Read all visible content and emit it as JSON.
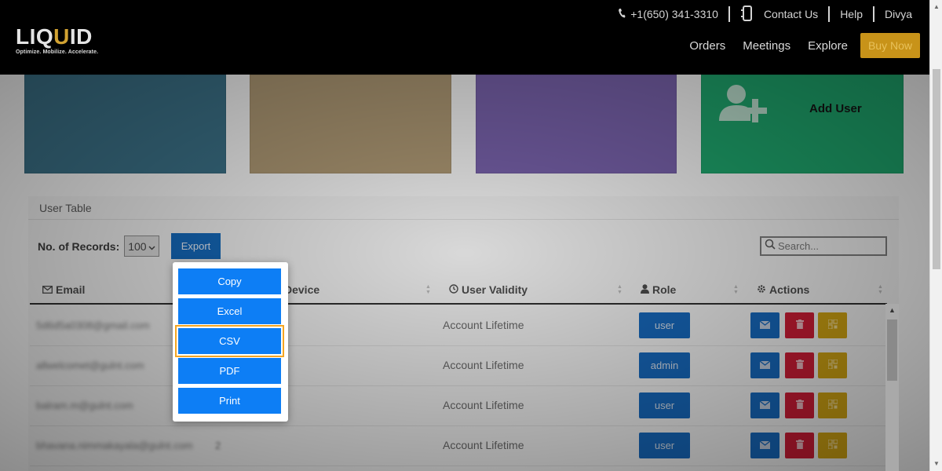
{
  "header": {
    "logo_main_prefix": "LIQ",
    "logo_main_accent": "U",
    "logo_main_suffix": "ID",
    "logo_tagline": "Optimize. Mobilize. Accelerate.",
    "phone": "+1(650) 341-3310",
    "contact_label": "Contact Us",
    "help_label": "Help",
    "user_name": "Divya",
    "nav": [
      "Orders",
      "Meetings",
      "Explore"
    ],
    "buy_label": "Buy Now"
  },
  "tiles": {
    "add_user_label": "Add User"
  },
  "table": {
    "panel_title": "User Table",
    "records_label": "No. of Records:",
    "records_value": "100",
    "export_label": "Export",
    "search_placeholder": "Search...",
    "columns": {
      "email": "Email",
      "device": "Device",
      "validity": "User Validity",
      "role": "Role",
      "actions": "Actions"
    },
    "rows": [
      {
        "email": "5d6d5a0308@gmail.com",
        "device": "",
        "validity": "Account Lifetime",
        "role": "user"
      },
      {
        "email": "allwelcomet@gulnt.com",
        "device": "",
        "validity": "Account Lifetime",
        "role": "admin"
      },
      {
        "email": "balram.m@gulnt.com",
        "device": "",
        "validity": "Account Lifetime",
        "role": "user"
      },
      {
        "email": "bhavana.nimmakayala@gulnt.com",
        "device": "2",
        "validity": "Account Lifetime",
        "role": "user"
      }
    ]
  },
  "export_menu": {
    "items": [
      "Copy",
      "Excel",
      "CSV",
      "PDF",
      "Print"
    ],
    "focused_item": "CSV"
  },
  "colors": {
    "primary": "#0d7ef5",
    "danger": "#c81c34",
    "warning": "#c99e12",
    "gold": "#c89319",
    "focus_ring": "#f5a623"
  }
}
